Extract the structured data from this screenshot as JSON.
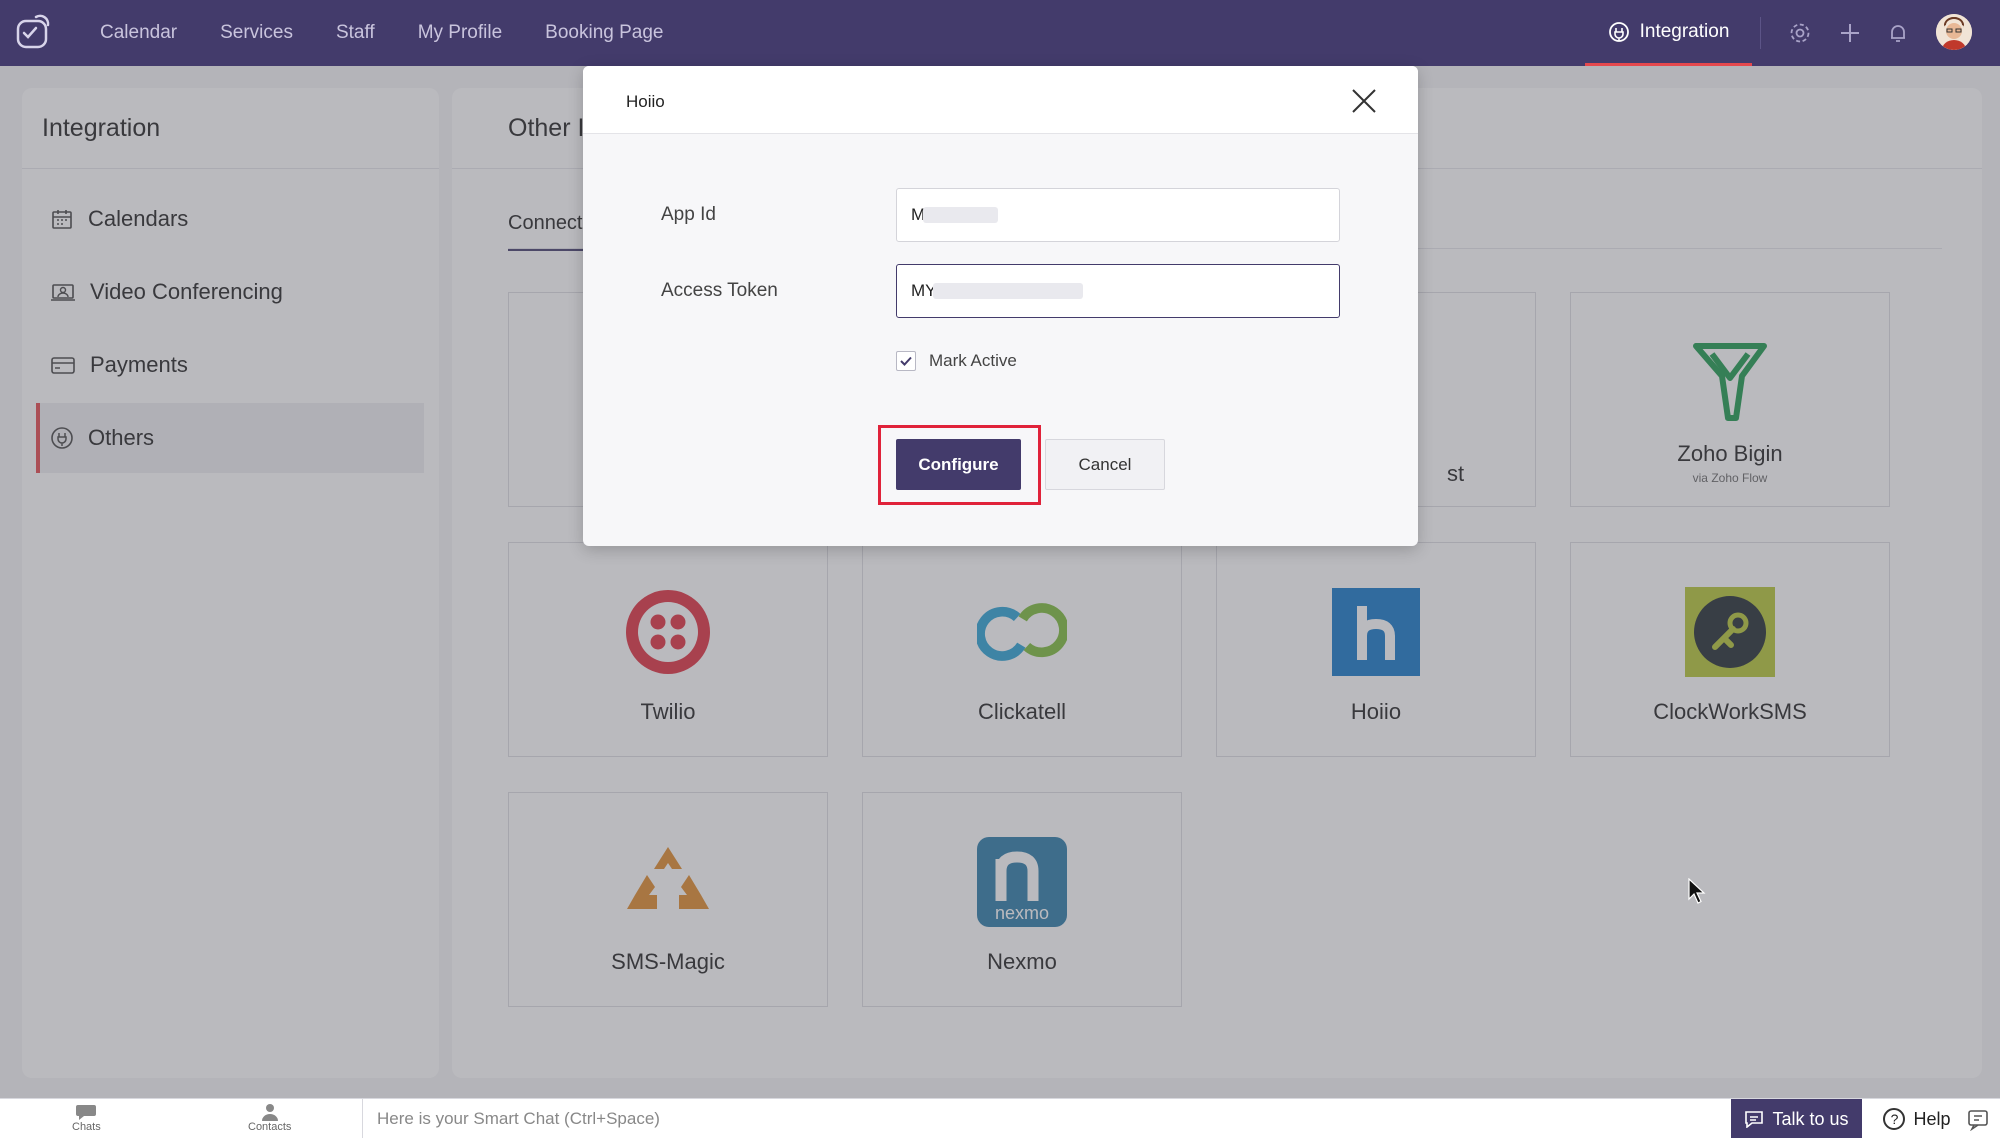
{
  "topbar": {
    "nav": [
      "Calendar",
      "Services",
      "Staff",
      "My Profile",
      "Booking Page"
    ],
    "active_tab": "Integration"
  },
  "sidebar": {
    "title": "Integration",
    "items": [
      {
        "label": "Calendars",
        "icon": "calendar-icon"
      },
      {
        "label": "Video Conferencing",
        "icon": "video-icon"
      },
      {
        "label": "Payments",
        "icon": "card-icon"
      },
      {
        "label": "Others",
        "icon": "plug-icon",
        "active": true
      }
    ]
  },
  "main": {
    "title_visible": "Other I",
    "tab_visible": "Connect",
    "partial_card_label": "st",
    "cards": [
      {
        "name": "Zoho Bigin",
        "sub": "via Zoho Flow"
      },
      {
        "name": "Twilio"
      },
      {
        "name": "Clickatell"
      },
      {
        "name": "Hoiio"
      },
      {
        "name": "ClockWorkSMS"
      },
      {
        "name": "SMS-Magic"
      },
      {
        "name": "Nexmo"
      }
    ]
  },
  "modal": {
    "title": "Hoiio",
    "app_id_label": "App Id",
    "app_id_value": "M",
    "access_token_label": "Access Token",
    "access_token_value": "MY",
    "mark_active_label": "Mark Active",
    "mark_active_checked": true,
    "configure_label": "Configure",
    "cancel_label": "Cancel"
  },
  "bottombar": {
    "chats_label": "Chats",
    "contacts_label": "Contacts",
    "smartchat_placeholder": "Here is your Smart Chat (Ctrl+Space)",
    "talk_label": "Talk to us",
    "help_label": "Help"
  },
  "colors": {
    "brand": "#433b6b",
    "accent_red": "#e5484d",
    "highlight": "#e0223a"
  }
}
